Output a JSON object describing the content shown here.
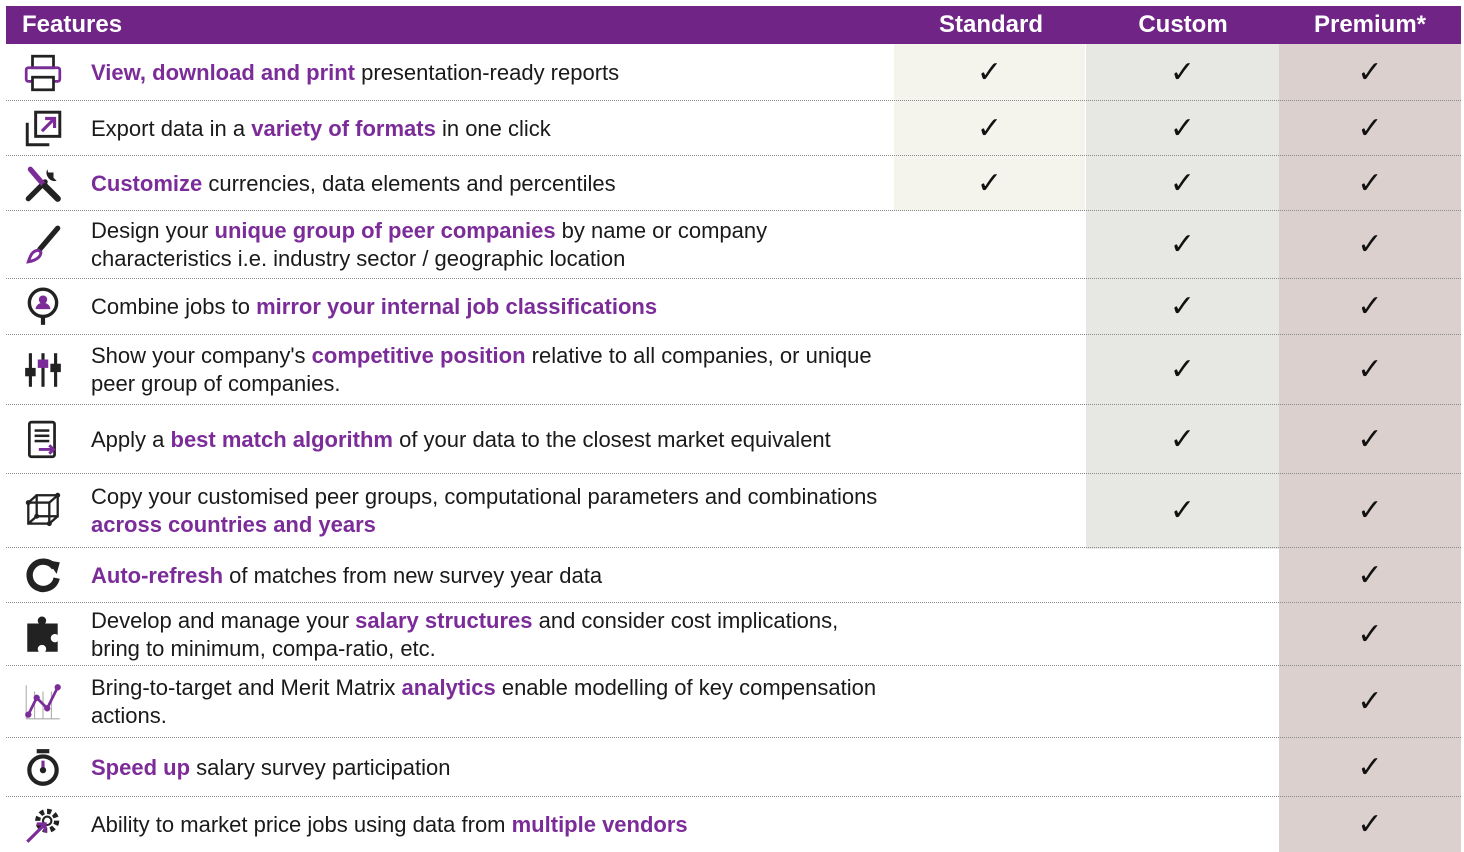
{
  "header": {
    "features": "Features",
    "standard": "Standard",
    "custom": "Custom",
    "premium": "Premium*"
  },
  "check_glyph": "✓",
  "accent_color": "#6f2486",
  "rows": [
    {
      "icon": "printer-icon",
      "pre": "",
      "bold": "View, download and print",
      "post": " presentation-ready reports",
      "standard": true,
      "custom": true,
      "premium": true
    },
    {
      "icon": "export-icon",
      "pre": "Export data in a ",
      "bold": "variety of formats",
      "post": " in one click",
      "standard": true,
      "custom": true,
      "premium": true
    },
    {
      "icon": "tools-icon",
      "pre": "",
      "bold": "Customize",
      "post": " currencies, data elements and percentiles",
      "standard": true,
      "custom": true,
      "premium": true
    },
    {
      "icon": "paintbrush-icon",
      "pre": "Design your ",
      "bold": "unique group of peer companies",
      "post": " by name or company characteristics i.e. industry sector / geographic location",
      "standard": false,
      "custom": true,
      "premium": true
    },
    {
      "icon": "person-icon",
      "pre": "Combine jobs to ",
      "bold": "mirror your internal job classifications",
      "post": "",
      "standard": false,
      "custom": true,
      "premium": true
    },
    {
      "icon": "sliders-icon",
      "pre": "Show your company's ",
      "bold": "competitive position",
      "post": " relative to all companies, or unique peer group of companies.",
      "standard": false,
      "custom": true,
      "premium": true
    },
    {
      "icon": "document-arrow-icon",
      "pre": "Apply a ",
      "bold": "best match algorithm",
      "post": " of your data to the closest market equivalent",
      "standard": false,
      "custom": true,
      "premium": true
    },
    {
      "icon": "cube-network-icon",
      "pre": "Copy your customised peer groups, computational parameters and combinations ",
      "bold": "across countries and years",
      "post": "",
      "standard": false,
      "custom": true,
      "premium": true
    },
    {
      "icon": "refresh-icon",
      "pre": "",
      "bold": "Auto-refresh",
      "post": " of matches from new survey year data",
      "standard": false,
      "custom": false,
      "premium": true
    },
    {
      "icon": "puzzle-icon",
      "pre": "Develop and manage your ",
      "bold": "salary structures",
      "post": " and consider cost implications, bring to minimum, compa-ratio, etc.",
      "standard": false,
      "custom": false,
      "premium": true
    },
    {
      "icon": "line-chart-icon",
      "pre": "Bring-to-target and Merit Matrix ",
      "bold": "analytics",
      "post": " enable modelling of key compensation actions.",
      "standard": false,
      "custom": false,
      "premium": true
    },
    {
      "icon": "stopwatch-icon",
      "pre": "",
      "bold": "Speed up",
      "post": " salary survey participation",
      "standard": false,
      "custom": false,
      "premium": true
    },
    {
      "icon": "gear-arrow-icon",
      "pre": "Ability to market price jobs using data from ",
      "bold": "multiple vendors",
      "post": "",
      "standard": false,
      "custom": false,
      "premium": true
    }
  ]
}
